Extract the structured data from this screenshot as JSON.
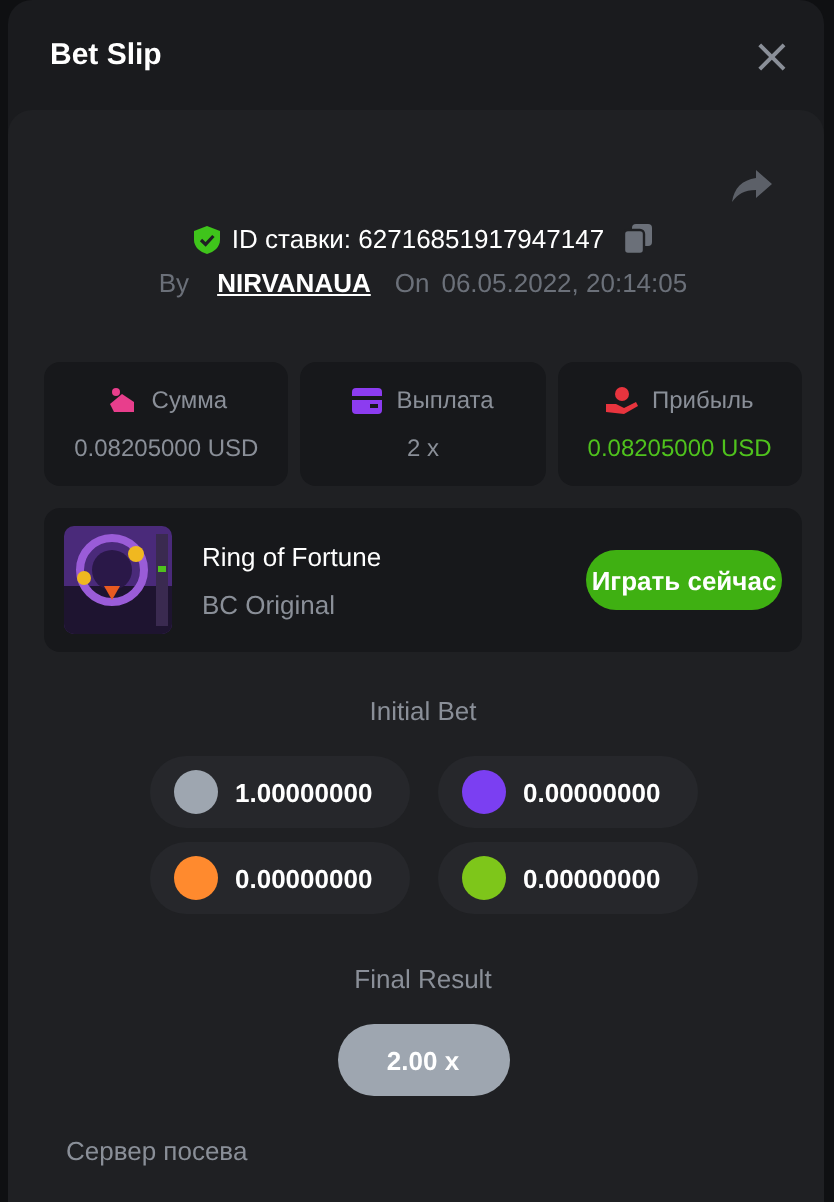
{
  "modal": {
    "title": "Bet Slip",
    "close_icon": "×"
  },
  "bet": {
    "id_label": "ID ставки: 62716851917947147",
    "by_label": "By",
    "user": "NIRVANAUA",
    "on_label": "On",
    "date": "06.05.2022, 20:14:05"
  },
  "stats": [
    {
      "kind": "stake",
      "label": "Сумма",
      "value": "0.08205000 USD"
    },
    {
      "kind": "payout",
      "label": "Выплата",
      "value": "2 x"
    },
    {
      "kind": "profit",
      "label": "Прибыль",
      "value": "0.08205000 USD"
    }
  ],
  "game": {
    "name": "Ring of Fortune",
    "provider": "BC Original",
    "play_button": "Играть сейчас"
  },
  "initial_bet": {
    "title": "Initial Bet",
    "chips": [
      {
        "color": "#9ea6b0",
        "value": "1.00000000"
      },
      {
        "color": "#7b3ff2",
        "value": "0.00000000"
      },
      {
        "color": "#ff8a2e",
        "value": "0.00000000"
      },
      {
        "color": "#7ec61a",
        "value": "0.00000000"
      }
    ]
  },
  "final_result": {
    "title": "Final Result",
    "value": "2.00 x"
  },
  "seed_section": {
    "title": "Сервер посева"
  }
}
